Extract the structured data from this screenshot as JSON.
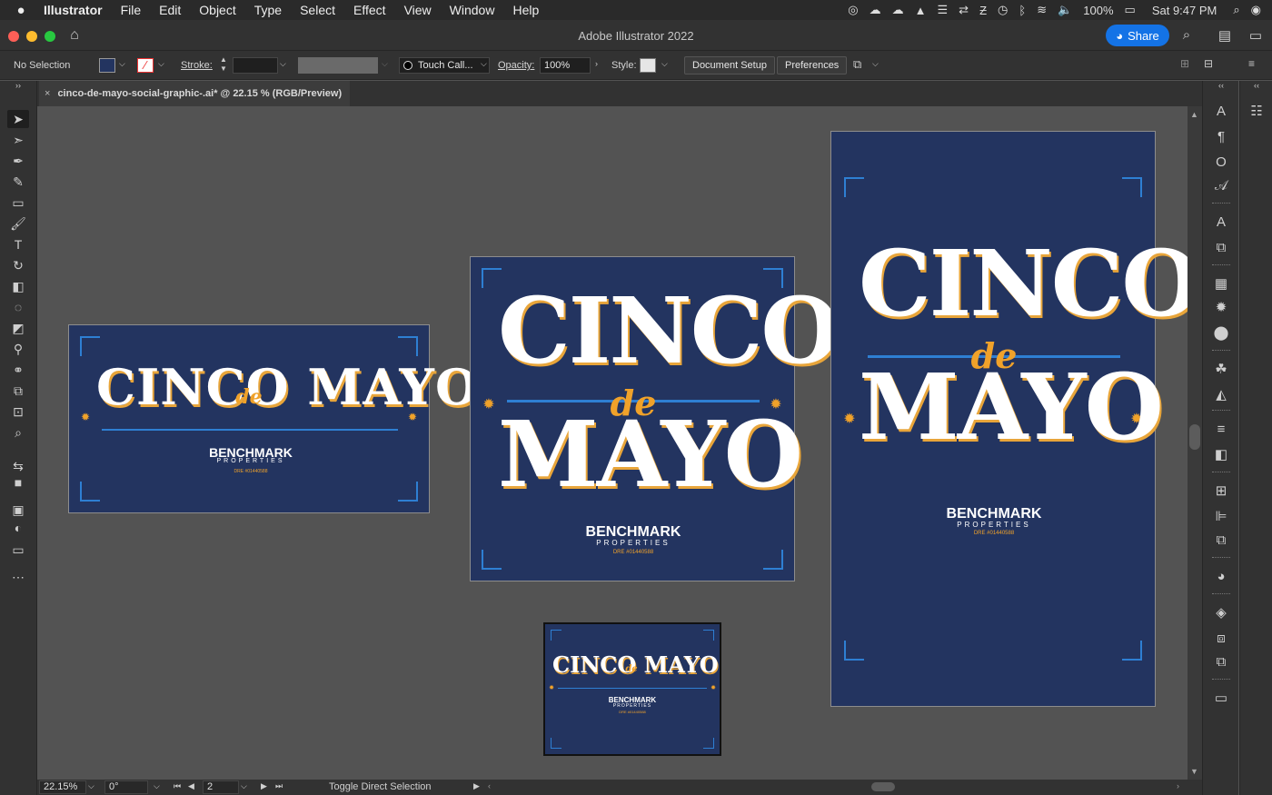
{
  "menubar": {
    "app_name": "Illustrator",
    "items": [
      "File",
      "Edit",
      "Object",
      "Type",
      "Select",
      "Effect",
      "View",
      "Window",
      "Help"
    ],
    "battery": "100%",
    "clock": "Sat 9:47 PM"
  },
  "window": {
    "title": "Adobe Illustrator 2022",
    "share_label": "Share"
  },
  "control_bar": {
    "selection": "No Selection",
    "fill_color": "#233460",
    "stroke_label": "Stroke:",
    "brush_label": "Touch Call...",
    "opacity_label": "Opacity:",
    "opacity_value": "100%",
    "style_label": "Style:",
    "document_setup": "Document Setup",
    "preferences": "Preferences"
  },
  "document_tab": {
    "close": "×",
    "name": "cinco-de-mayo-social-graphic-.ai* @ 22.15 % (RGB/Preview)"
  },
  "left_tools": [
    {
      "name": "selection-tool-icon",
      "glyph": "➤",
      "active": true
    },
    {
      "name": "direct-selection-tool-icon",
      "glyph": "➣"
    },
    {
      "name": "pen-tool-icon",
      "glyph": "✒"
    },
    {
      "name": "curvature-tool-icon",
      "glyph": "✎"
    },
    {
      "name": "rectangle-tool-icon",
      "glyph": "▭"
    },
    {
      "name": "paintbrush-tool-icon",
      "glyph": "🖌"
    },
    {
      "name": "type-tool-icon",
      "glyph": "T"
    },
    {
      "name": "rotate-tool-icon",
      "glyph": "↻"
    },
    {
      "name": "eraser-tool-icon",
      "glyph": "◧"
    },
    {
      "name": "lasso-tool-icon",
      "glyph": "◌"
    },
    {
      "name": "gradient-tool-icon",
      "glyph": "◩"
    },
    {
      "name": "eyedropper-tool-icon",
      "glyph": "⚲"
    },
    {
      "name": "blend-tool-icon",
      "glyph": "⚭"
    },
    {
      "name": "shape-builder-tool-icon",
      "glyph": "⧉"
    },
    {
      "name": "artboard-tool-icon",
      "glyph": "⊡"
    },
    {
      "name": "zoom-tool-icon",
      "glyph": "⌕"
    }
  ],
  "artboards": {
    "cinco": "CINCO",
    "mayo": "MAYO",
    "cinco_mayo": "CINCO MAYO",
    "de": "de",
    "brand": "BENCHMARK",
    "brand_sub": "PROPERTIES",
    "dre": "DRE #01440588",
    "star": "✹"
  },
  "status_bar": {
    "zoom": "22.15%",
    "rotation": "0°",
    "artboard_number": "2",
    "status_text": "Toggle Direct Selection"
  }
}
